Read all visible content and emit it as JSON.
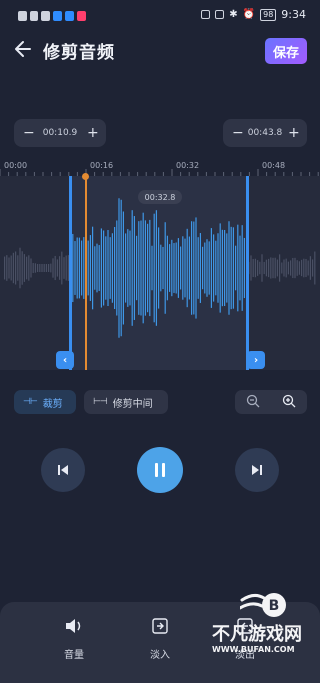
{
  "status_bar": {
    "time": "9:34",
    "battery": "98"
  },
  "header": {
    "title": "修剪音频",
    "save_label": "保存"
  },
  "range": {
    "start_time": "00:10.9",
    "end_time": "00:43.8",
    "minus": "−",
    "plus": "+"
  },
  "ruler": {
    "ticks": [
      "00:00",
      "00:16",
      "00:32",
      "00:48"
    ]
  },
  "waveform": {
    "current_time": "00:32.8"
  },
  "modes": {
    "trim_label": "裁剪",
    "trim_middle_label": "修剪中间"
  },
  "tools": {
    "volume_label": "音量",
    "fade_in_label": "淡入",
    "fade_out_label": "淡出"
  },
  "watermark": {
    "text": "不凡游戏网",
    "url": "WWW.BUFAN.COM"
  },
  "colors": {
    "background": "#1e2334",
    "accent_blue": "#3a8ff0",
    "playhead_orange": "#e48b32",
    "save_gradient": "#6a74ff"
  }
}
